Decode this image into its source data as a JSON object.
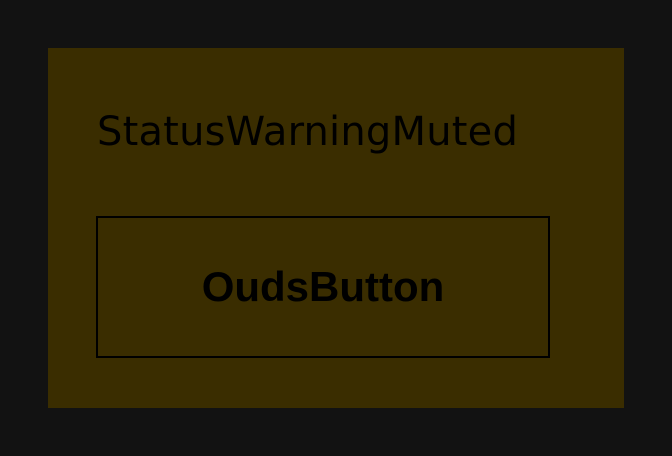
{
  "panel": {
    "title": "StatusWarningMuted",
    "button_label": "OudsButton"
  },
  "colors": {
    "background": "#121212",
    "panel_background": "#3a2d00",
    "text": "#000000",
    "button_border": "#000000"
  }
}
